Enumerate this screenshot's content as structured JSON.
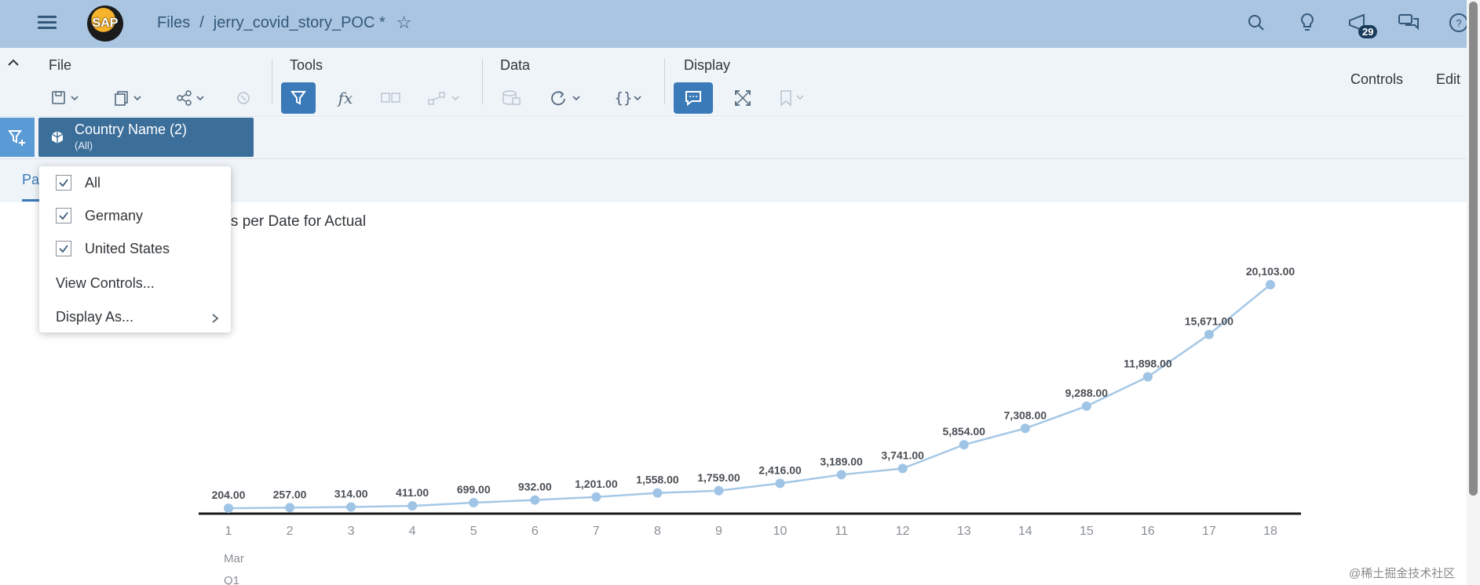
{
  "shellbar": {
    "logo_text": "SAP",
    "breadcrumb_root": "Files",
    "breadcrumb_sep": "/",
    "story_name": "jerry_covid_story_POC *",
    "notification_count": "29"
  },
  "toolbar": {
    "groups": [
      "File",
      "Tools",
      "Data",
      "Display"
    ],
    "controls_label": "Controls",
    "edit_label": "Edit"
  },
  "filterbar": {
    "token_name": "Country Name (2)",
    "token_value": "(All)"
  },
  "tabs": {
    "page_label": "Pa"
  },
  "chart_title": "s Hopkins per Date for Actual",
  "dropdown": {
    "items": [
      "All",
      "Germany",
      "United States"
    ],
    "view_controls": "View Controls...",
    "display_as": "Display As..."
  },
  "chart_data": {
    "type": "line",
    "categories": [
      "1",
      "2",
      "3",
      "4",
      "5",
      "6",
      "7",
      "8",
      "9",
      "10",
      "11",
      "12",
      "13",
      "14",
      "15",
      "16",
      "17",
      "18"
    ],
    "values": [
      204,
      257,
      314,
      411,
      699,
      932,
      1201,
      1558,
      1759,
      2416,
      3189,
      3741,
      5854,
      7308,
      9288,
      11898,
      15671,
      20103
    ],
    "labels": [
      "204.00",
      "257.00",
      "314.00",
      "411.00",
      "699.00",
      "932.00",
      "1,201.00",
      "1,558.00",
      "1,759.00",
      "2,416.00",
      "3,189.00",
      "3,741.00",
      "5,854.00",
      "7,308.00",
      "9,288.00",
      "11,898.00",
      "15,671.00",
      "20,103.00"
    ],
    "x_sublabels": [
      "Mar",
      "Q1"
    ],
    "line_color": "#a5c8e6",
    "point_color": "#9fc4e6",
    "axis_color": "#1a1a1a"
  },
  "watermark": "@稀土掘金技术社区"
}
